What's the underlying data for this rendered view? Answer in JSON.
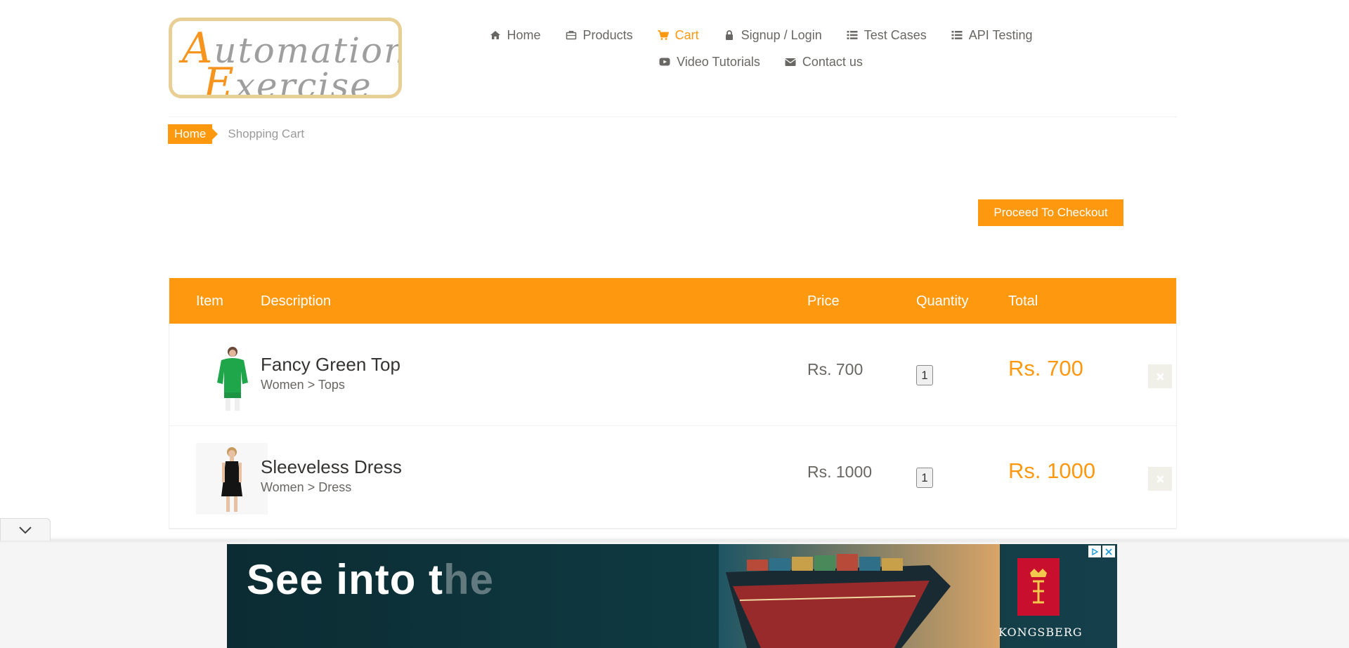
{
  "logo": {
    "line1_cap": "A",
    "line1_rest": "utomation",
    "line2_cap": "E",
    "line2_rest": "xercise"
  },
  "nav": {
    "items": [
      {
        "label": "Home",
        "icon": "home-icon"
      },
      {
        "label": "Products",
        "icon": "briefcase-icon"
      },
      {
        "label": "Cart",
        "icon": "shopping-cart-icon",
        "active": true
      },
      {
        "label": "Signup / Login",
        "icon": "lock-icon"
      },
      {
        "label": "Test Cases",
        "icon": "list-icon"
      },
      {
        "label": "API Testing",
        "icon": "list-icon"
      },
      {
        "label": "Video Tutorials",
        "icon": "youtube-play-icon"
      },
      {
        "label": "Contact us",
        "icon": "envelope-icon"
      }
    ]
  },
  "breadcrumb": {
    "home": "Home",
    "current": "Shopping Cart"
  },
  "checkout": {
    "label": "Proceed To Checkout"
  },
  "cart": {
    "columns": {
      "item": "Item",
      "description": "Description",
      "price": "Price",
      "quantity": "Quantity",
      "total": "Total"
    },
    "rows": [
      {
        "name": "Fancy Green Top",
        "category": "Women > Tops",
        "price": "Rs. 700",
        "quantity": "1",
        "total": "Rs. 700"
      },
      {
        "name": "Sleeveless Dress",
        "category": "Women > Dress",
        "price": "Rs. 1000",
        "quantity": "1",
        "total": "Rs. 1000"
      }
    ]
  },
  "ad": {
    "headline_visible": "See into t",
    "headline_fading": "he",
    "brand": "KONGSBERG"
  },
  "colors": {
    "accent": "#fe980f",
    "text": "#696763",
    "ad_background": "#0f3a42",
    "brand_red": "#c8102e"
  }
}
